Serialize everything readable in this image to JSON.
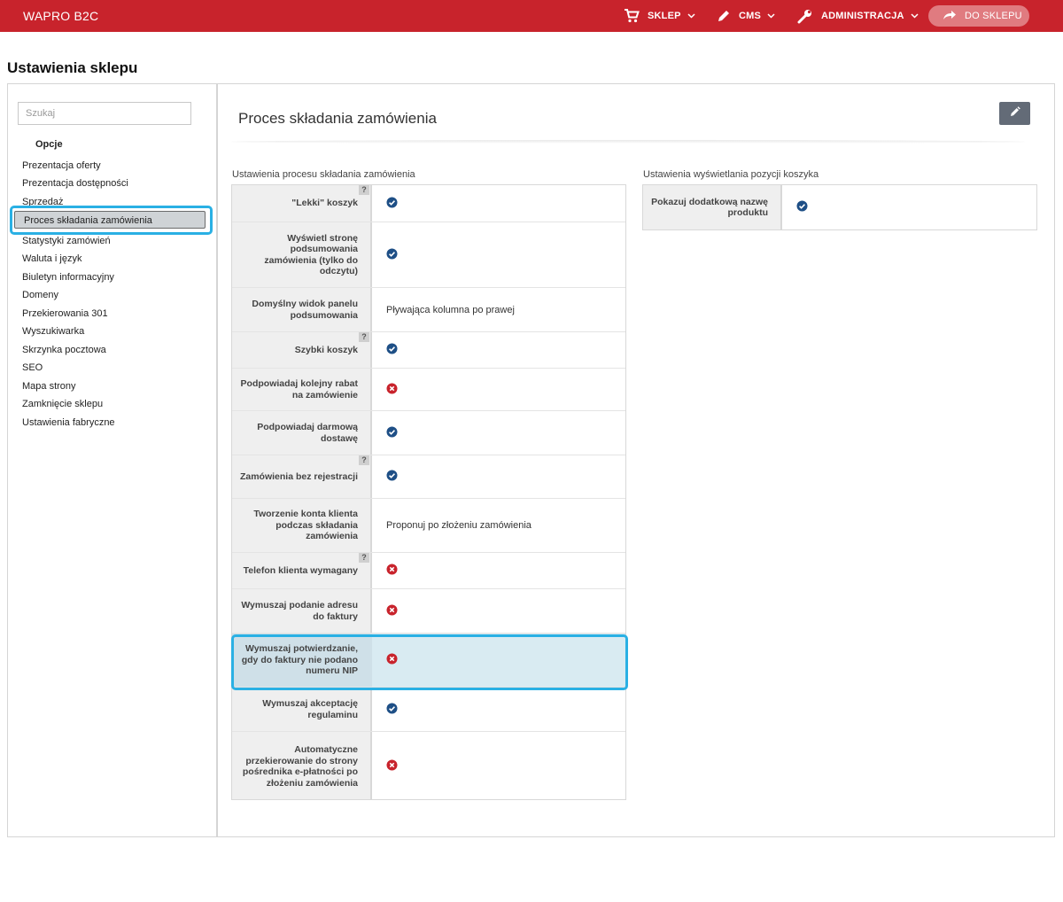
{
  "topbar": {
    "brand": "WAPRO B2C",
    "nav": [
      {
        "label": "SKLEP",
        "icon": "cart-icon"
      },
      {
        "label": "CMS",
        "icon": "pencil-icon"
      },
      {
        "label": "ADMINISTRACJA",
        "icon": "wrench-icon"
      }
    ],
    "shop_button": "DO SKLEPU"
  },
  "page_title": "Ustawienia sklepu",
  "sidebar": {
    "search_placeholder": "Szukaj",
    "options_title": "Opcje",
    "items": [
      "Prezentacja oferty",
      "Prezentacja dostępności",
      "Sprzedaż",
      "Proces składania zamówienia",
      "Statystyki zamówień",
      "Waluta i język",
      "Biuletyn informacyjny",
      "Domeny",
      "Przekierowania 301",
      "Wyszukiwarka",
      "Skrzynka pocztowa",
      "SEO",
      "Mapa strony",
      "Zamknięcie sklepu",
      "Ustawienia fabryczne"
    ],
    "active_index": 3
  },
  "content": {
    "title": "Proces składania zamówienia",
    "section1": {
      "title": "Ustawienia procesu składania zamówienia",
      "rows": [
        {
          "label": "\"Lekki\" koszyk",
          "type": "check",
          "value": "yes",
          "help": "?"
        },
        {
          "label": "Wyświetl stronę podsumowania zamówienia (tylko do odczytu)",
          "type": "check",
          "value": "yes"
        },
        {
          "label": "Domyślny widok panelu podsumowania",
          "type": "text",
          "value": "Pływająca kolumna po prawej"
        },
        {
          "label": "Szybki koszyk",
          "type": "check",
          "value": "yes",
          "help": "?"
        },
        {
          "label": "Podpowiadaj kolejny rabat na zamówienie",
          "type": "check",
          "value": "no"
        },
        {
          "label": "Podpowiadaj darmową dostawę",
          "type": "check",
          "value": "yes"
        },
        {
          "label": "Zamówienia bez rejestracji",
          "type": "check",
          "value": "yes",
          "help": "?"
        },
        {
          "label": "Tworzenie konta klienta podczas składania zamówienia",
          "type": "text",
          "value": "Proponuj po złożeniu zamówienia"
        },
        {
          "label": "Telefon klienta wymagany",
          "type": "check",
          "value": "no",
          "help": "?"
        },
        {
          "label": "Wymuszaj podanie adresu do faktury",
          "type": "check",
          "value": "no"
        },
        {
          "label": "Wymuszaj potwierdzanie, gdy do faktury nie podano numeru NIP",
          "type": "check",
          "value": "no"
        },
        {
          "label": "Wymuszaj akceptację regulaminu",
          "type": "check",
          "value": "yes"
        },
        {
          "label": "Automatyczne przekierowanie do strony pośrednika e-płatności po złożeniu zamówienia",
          "type": "check",
          "value": "no"
        }
      ]
    },
    "section2": {
      "title": "Ustawienia wyświetlania pozycji koszyka",
      "rows": [
        {
          "label": "Pokazuj dodatkową nazwę produktu",
          "type": "check",
          "value": "yes"
        }
      ]
    }
  },
  "colors": {
    "topbar": "#c8232c",
    "check": "#1e4f86",
    "cross": "#c8232c",
    "highlight_border": "#2ab0e4"
  }
}
